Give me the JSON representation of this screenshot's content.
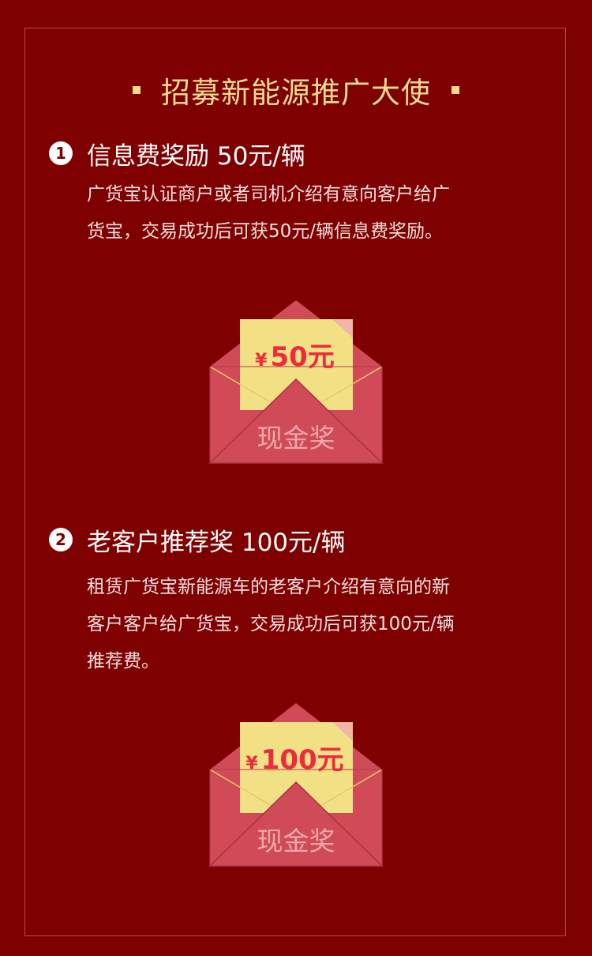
{
  "header": {
    "title": "招募新能源推广大使"
  },
  "sections": [
    {
      "badge": "1",
      "title": "信息费奖励 50元/辆",
      "lines": [
        "广货宝认证商户或者司机介绍有意向客户给广",
        "货宝，交易成功后可获50元/辆信息费奖励。"
      ],
      "reward": {
        "currency_symbol": "¥",
        "amount": "50元",
        "label": "现金奖"
      }
    },
    {
      "badge": "2",
      "title": "老客户推荐奖 100元/辆",
      "lines": [
        "租赁广货宝新能源车的老客户介绍有意向的新",
        "客户客户给广货宝，交易成功后可获100元/辆",
        "推荐费。"
      ],
      "reward": {
        "currency_symbol": "¥",
        "amount": "100元",
        "label": "现金奖"
      }
    }
  ],
  "colors": {
    "background": "#7f0000",
    "title": "#f2dc8c",
    "envelope": "#d14a57",
    "card": "#f2e085",
    "amount": "#ee2a3c"
  }
}
